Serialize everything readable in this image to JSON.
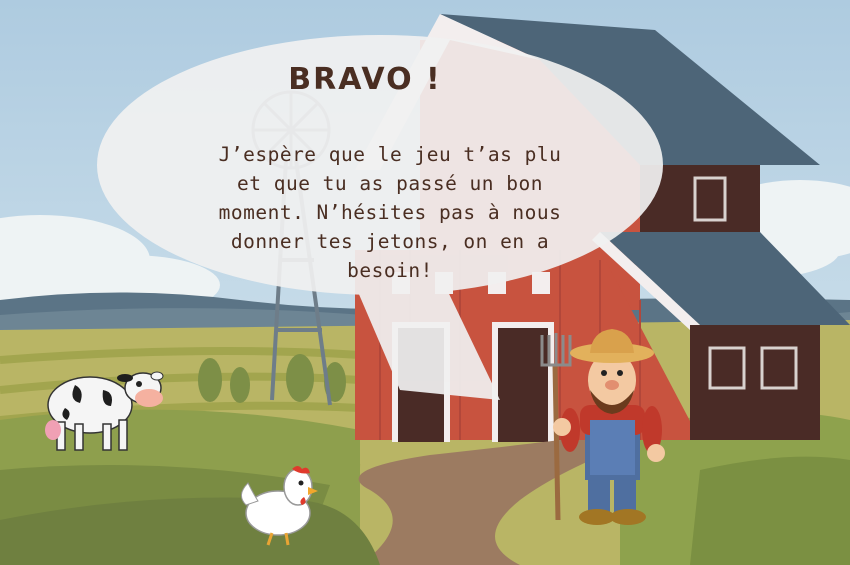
{
  "dialog": {
    "title": "BRAVO !",
    "message": "J’espère que le jeu t’as plu\net que tu as passé un bon\nmoment. N’hésites pas à nous\ndonner tes jetons, on en a\nbesoin!"
  },
  "colors": {
    "sky": "#b9d3e4",
    "barn_red": "#c8533f",
    "barn_roof": "#4d6578",
    "barn_dark": "#4a2b26",
    "grass": "#a8b15a",
    "path": "#9c7b61",
    "text": "#4a2e22"
  },
  "characters": [
    "farmer",
    "cow",
    "chicken"
  ]
}
